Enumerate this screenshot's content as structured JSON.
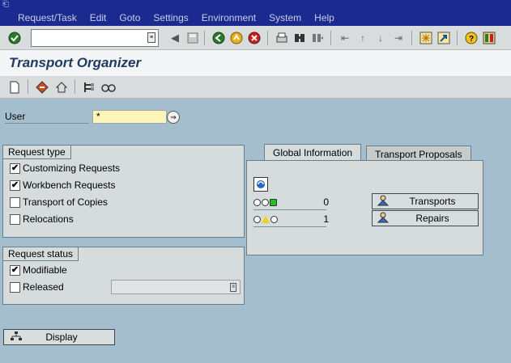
{
  "menubar": {
    "items": [
      "Request/Task",
      "Edit",
      "Goto",
      "Settings",
      "Environment",
      "System",
      "Help"
    ]
  },
  "toolbar": {
    "command_field_value": "",
    "icons": [
      "enter-icon",
      "back-icon",
      "exit-icon",
      "cancel-icon",
      "print-icon",
      "find-icon",
      "find-next-icon",
      "first-page-icon",
      "prev-page-icon",
      "next-page-icon",
      "last-page-icon",
      "create-session-icon",
      "shortcut-icon",
      "help-icon",
      "layout-menu-icon"
    ]
  },
  "title": "Transport Organizer",
  "user": {
    "label": "User",
    "value": "*"
  },
  "request_type": {
    "title": "Request type",
    "options": [
      {
        "label": "Customizing Requests",
        "checked": true
      },
      {
        "label": "Workbench Requests",
        "checked": true
      },
      {
        "label": "Transport of Copies",
        "checked": false
      },
      {
        "label": "Relocations",
        "checked": false
      }
    ]
  },
  "request_status": {
    "title": "Request status",
    "options": [
      {
        "label": "Modifiable",
        "checked": true
      },
      {
        "label": "Released",
        "checked": false
      }
    ],
    "released_value": ""
  },
  "tabs": {
    "items": [
      "Global Information",
      "Transport Proposals"
    ],
    "active": "Global Information"
  },
  "global_info": {
    "rows": [
      {
        "status": "red-red-green",
        "count": "0",
        "button": "Transports"
      },
      {
        "status": "red-yellow-red",
        "count": "1",
        "button": "Repairs"
      }
    ]
  },
  "display_button": "Display",
  "colors": {
    "menubar_bg": "#1a2a8e",
    "background": "#a4bece",
    "title_color": "#1f3b62",
    "input_required": "#fff5b8"
  }
}
